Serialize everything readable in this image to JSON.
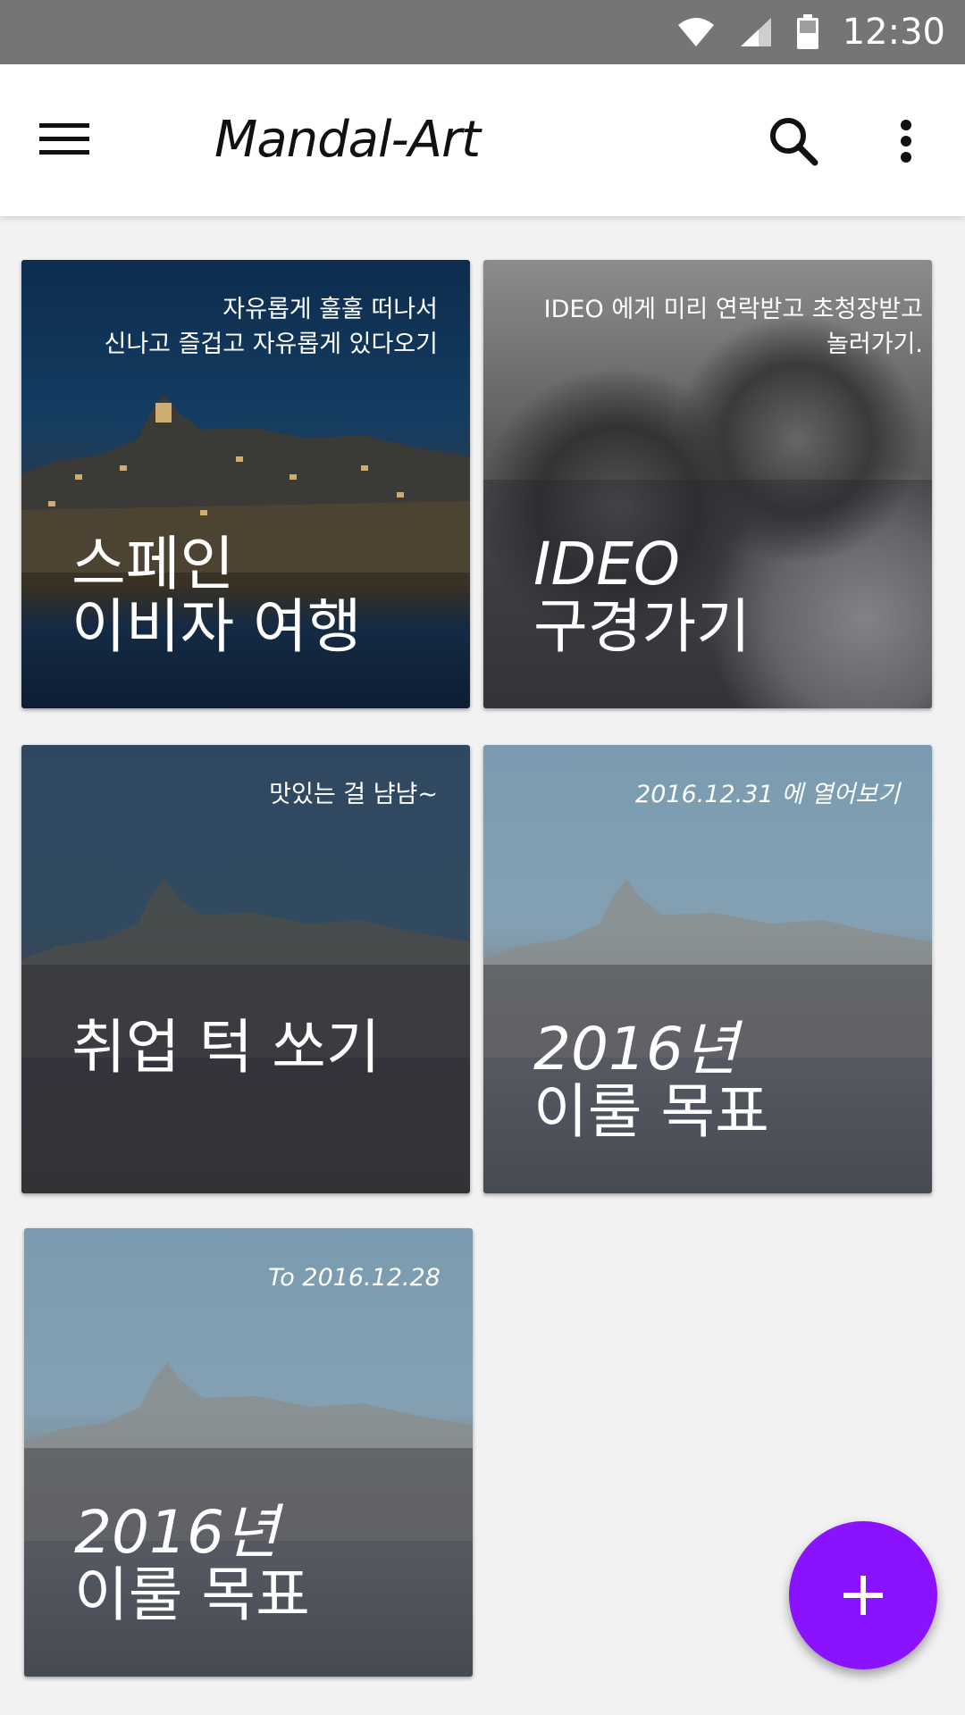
{
  "status_bar": {
    "time": "12:30",
    "icons": [
      "wifi-icon",
      "cell-signal-icon",
      "battery-icon"
    ]
  },
  "app_bar": {
    "title": "Mandal-Art",
    "icons": [
      "menu-icon",
      "search-icon",
      "more-vert-icon"
    ]
  },
  "cards": [
    {
      "subtitle": "자유롭게 훌훌 떠나서\n신나고 즐겁고 자유롭게 있다오기",
      "title_line1": "스페인",
      "title_line2": "이비자 여행",
      "background": "night-harbor"
    },
    {
      "subtitle": "IDEO 에게 미리 연락받고 초청장받고\n놀러가기.",
      "title_line1": "IDEO",
      "title_line2": "구경가기",
      "background": "grayscale-people"
    },
    {
      "subtitle": "맛있는 걸 냠냠~",
      "title_line1": "취업 턱 쏘기",
      "title_line2": "",
      "background": "dark-harbor"
    },
    {
      "subtitle": "2016.12.31 에 열어보기",
      "title_line1": "2016년",
      "title_line2": "이룰 목표",
      "background": "dusk-harbor"
    },
    {
      "subtitle": "To 2016.12.28",
      "title_line1": "2016년",
      "title_line2": "이룰 목표",
      "background": "dusk-harbor"
    }
  ],
  "fab": {
    "label": "+",
    "icon": "add-icon",
    "color": "#8a12ff"
  },
  "colors": {
    "status_bar": "#757575",
    "app_bar": "#ffffff",
    "background": "#f2f2f2"
  }
}
